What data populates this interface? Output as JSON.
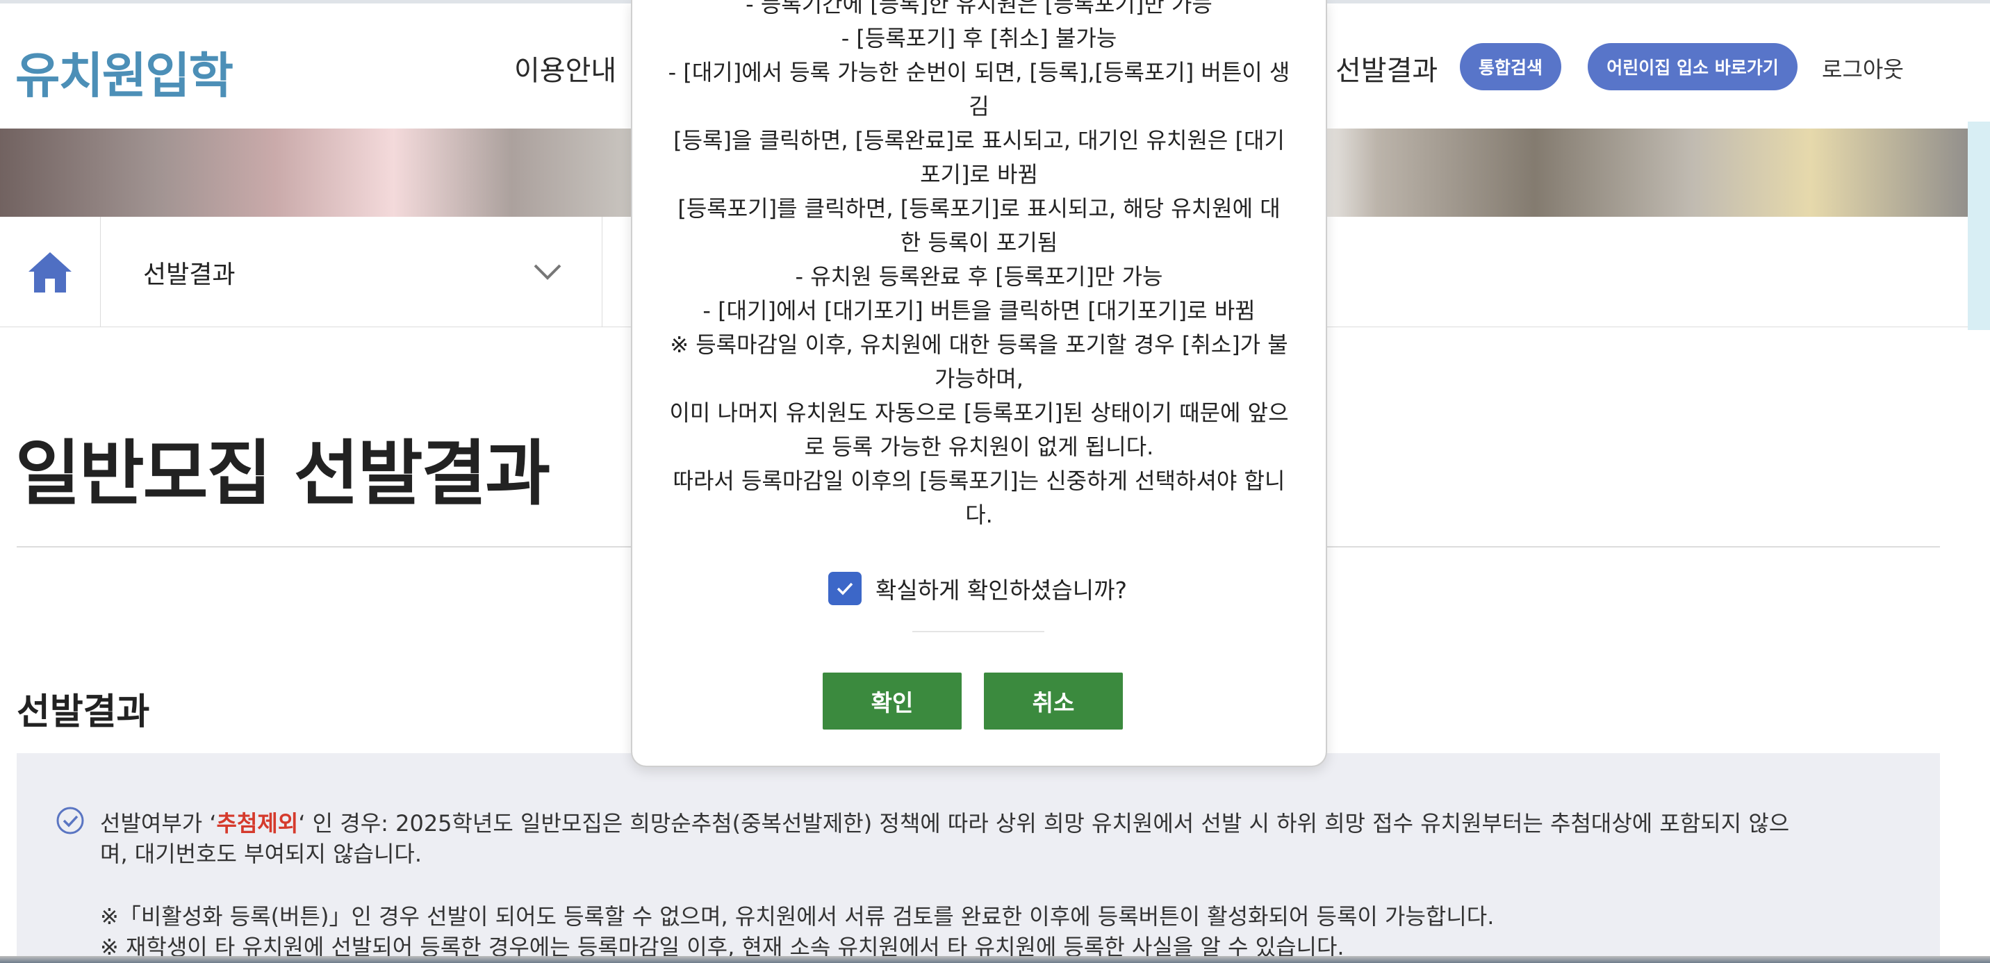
{
  "header": {
    "logo": "유치원입학",
    "nav": [
      "이용안내",
      "선발결과"
    ],
    "buttons": [
      "통합검색",
      "어린이집 입소 바로가기"
    ],
    "logout": "로그아웃"
  },
  "subnav": {
    "selected": "선발결과"
  },
  "page": {
    "title": "일반모집 선발결과",
    "section_title": "선발결과"
  },
  "notice": {
    "line1_prefix": "선발여부가 ‘",
    "line1_highlight": "추첨제외",
    "line1_suffix": "‘ 인 경우: 2025학년도 일반모집은 희망순추첨(중복선발제한) 정책에 따라 상위 희망 유치원에서 선발 시 하위 희망 접수 유치원부터는 추첨대상에 포함되지 않으",
    "line2": "며, 대기번호도 부여되지 않습니다.",
    "line3": "※「비활성화 등록(버튼)」인 경우 선발이 되어도 등록할 수 없으며, 유치원에서 서류 검토를 완료한 이후에 등록버튼이 활성화되어 등록이 가능합니다.",
    "line4": "※ 재학생이 타 유치원에 선발되어 등록한 경우에는 등록마감일 이후, 현재 소속 유치원에서 타 유치원에 등록한 사실을 알 수 있습니다."
  },
  "modal": {
    "lines": [
      "- 등록기간에 [등록]한 유치원은 [등록포기]만 가능",
      "- [등록포기] 후 [취소] 불가능",
      "- [대기]에서 등록 가능한 순번이 되면, [등록],[등록포기] 버튼이 생",
      "김",
      "[등록]을 클릭하면, [등록완료]로 표시되고, 대기인 유치원은 [대기",
      "포기]로 바뀜",
      "[등록포기]를 클릭하면, [등록포기]로 표시되고, 해당 유치원에 대",
      "한 등록이 포기됨",
      "- 유치원 등록완료 후 [등록포기]만 가능",
      "- [대기]에서 [대기포기] 버튼을 클릭하면 [대기포기]로 바뀜",
      "※ 등록마감일 이후, 유치원에 대한 등록을 포기할 경우 [취소]가 불",
      "가능하며,",
      "이미 나머지 유치원도 자동으로 [등록포기]된 상태이기 때문에 앞으",
      "로 등록 가능한 유치원이 없게 됩니다.",
      "따라서 등록마감일 이후의 [등록포기]는 신중하게 선택하셔야 합니",
      "다."
    ],
    "confirm_label": "확실하게 확인하셨습니까?",
    "confirm_checked": true,
    "ok_label": "확인",
    "cancel_label": "취소"
  },
  "colors": {
    "logo": "#4c8fb7",
    "pill": "#5875c9",
    "checkbox": "#3c67c8",
    "modal_button": "#3b8a3e",
    "highlight": "#d53a2c"
  }
}
